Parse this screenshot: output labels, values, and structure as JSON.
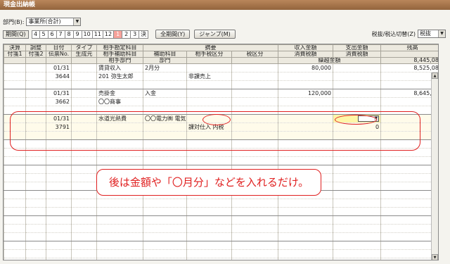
{
  "window": {
    "title": "現金出納帳"
  },
  "dept": {
    "label": "部門(B):",
    "value": "事業所(合計)"
  },
  "period": {
    "label": "期間(Q)",
    "months": [
      "4",
      "5",
      "6",
      "7",
      "8",
      "9",
      "10",
      "11",
      "12",
      "1",
      "2",
      "3",
      "決"
    ],
    "selected": "1"
  },
  "buttons": {
    "full_period": "全期間(Y)",
    "jump": "ジャンプ(M)"
  },
  "tax": {
    "label": "税抜/税込切替(Z)",
    "value": "税抜"
  },
  "headers": {
    "r1": [
      "決算",
      "調整",
      "日付",
      "タイプ",
      "相手勘定科目",
      "摘要",
      "収入金額",
      "支出金額",
      "残高"
    ],
    "r2": [
      "付箋1",
      "付箋2",
      "伝票No.",
      "生成元",
      "相手補助科目",
      "補助科目",
      "相手税区分",
      "税区分",
      "消費税額",
      "消費税額"
    ],
    "r3": [
      "相手部門",
      "部門",
      "繰越金額"
    ]
  },
  "carry_balance": "8,445,082",
  "entries": [
    {
      "date": "01/31",
      "no": "3644",
      "account": "賃貸収入",
      "sub": "201 弥生太郎",
      "memo": "2月分",
      "tax_cls": "非課売上",
      "income": "80,000",
      "expense": "",
      "balance": "8,525,082",
      "tax_in": "",
      "tax_out": ""
    },
    {
      "date": "01/31",
      "no": "3662",
      "account": "売掛金",
      "sub": "〇〇商事",
      "memo": "入金",
      "tax_cls": "",
      "income": "120,000",
      "expense": "",
      "balance": "8,645,082",
      "tax_in": "",
      "tax_out": ""
    },
    {
      "date": "01/31",
      "no": "3791",
      "account": "水道光熱費",
      "sub": "",
      "memo": "〇〇電力㈱ 電気代",
      "tax_cls": "課対仕入 内税",
      "income": "",
      "expense": "0",
      "balance": "",
      "tax_in": "",
      "tax_out": "0"
    }
  ],
  "annotation": "後は金額や「〇月分」などを入れるだけ。"
}
